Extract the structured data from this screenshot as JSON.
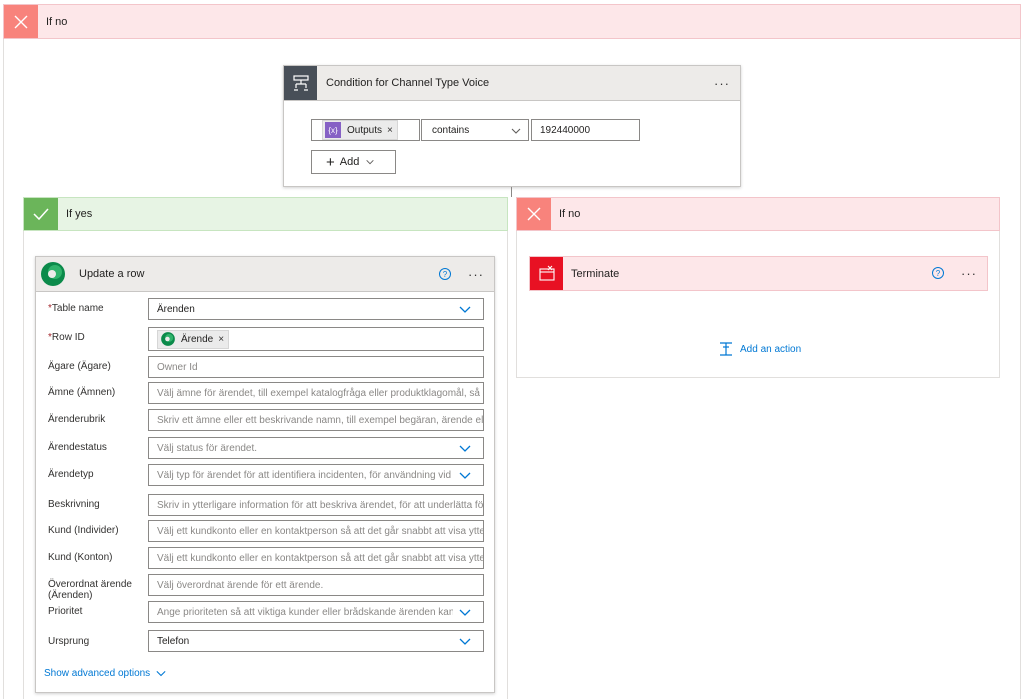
{
  "top_branch": {
    "label": "If no"
  },
  "condition": {
    "title": "Condition for Channel Type Voice",
    "more": "···",
    "token": "Outputs",
    "token_remove": "×",
    "operator": "contains",
    "value": "192440000",
    "add_label": "Add"
  },
  "yes_branch": {
    "label": "If yes"
  },
  "no_branch": {
    "label": "If no"
  },
  "update_row": {
    "title": "Update a row",
    "help": "?",
    "more": "···",
    "fields": {
      "table_name": {
        "label": "Table name",
        "required": "*",
        "value": "Ärenden"
      },
      "row_id": {
        "label": "Row ID",
        "required": "*",
        "token": "Ärende",
        "token_remove": "×"
      },
      "agare": {
        "label": "Ägare (Ägare)",
        "placeholder": "Owner Id"
      },
      "amne": {
        "label": "Ämne (Ämnen)",
        "placeholder": "Välj ämne för ärendet, till exempel katalogfråga eller produktklagomål, så att ku"
      },
      "arenderubrik": {
        "label": "Ärenderubrik",
        "placeholder": "Skriv ett ämne eller ett beskrivande namn, till exempel begäran, ärende eller för"
      },
      "arendestatus": {
        "label": "Ärendestatus",
        "placeholder": "Välj status för ärendet."
      },
      "arendetyp": {
        "label": "Ärendetyp",
        "placeholder": "Välj typ för ärendet för att identifiera incidenten, för användning vid ärend"
      },
      "beskrivning": {
        "label": "Beskrivning",
        "placeholder": "Skriv in ytterligare information för att beskriva ärendet, för att underlätta för ku"
      },
      "kund_individer": {
        "label": "Kund (Individer)",
        "placeholder": "Välj ett kundkonto eller en kontaktperson så att det går snabbt att visa ytterliga"
      },
      "kund_konton": {
        "label": "Kund (Konton)",
        "placeholder": "Välj ett kundkonto eller en kontaktperson så att det går snabbt att visa ytterliga"
      },
      "overordnat": {
        "label": "Överordnat ärende (Ärenden)",
        "placeholder": "Välj överordnat ärende för ett ärende."
      },
      "prioritet": {
        "label": "Prioritet",
        "placeholder": "Ange prioriteten så att viktiga kunder eller brådskande ärenden kan hante"
      },
      "ursprung": {
        "label": "Ursprung",
        "value": "Telefon"
      }
    },
    "advanced_label": "Show advanced options"
  },
  "terminate": {
    "title": "Terminate",
    "help": "?",
    "more": "···"
  },
  "add_action_label": "Add an action",
  "colors": {
    "no_header_bg": "#fde7e9",
    "no_icon": "#f8837c",
    "yes_header_bg": "#e7f4e4",
    "yes_icon": "#6bb55a",
    "condition_icon": "#484f58",
    "terminate_icon": "#e81123",
    "accent": "#0078d4",
    "token_icon": "#8661c5"
  }
}
